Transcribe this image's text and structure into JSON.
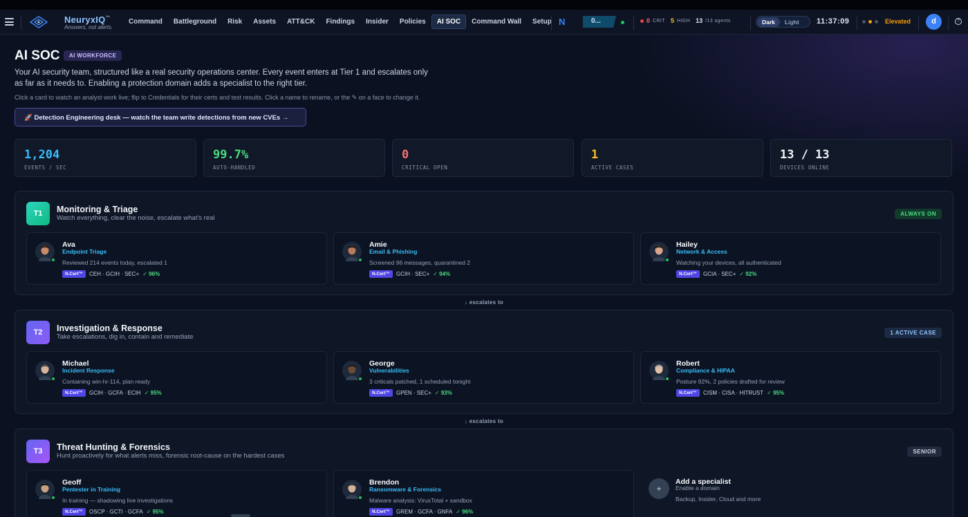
{
  "nav": {
    "brand": "NeuryxIQ",
    "brand_mark": "™",
    "tagline": "Answers, not alerts.",
    "links": [
      "Command",
      "Battleground",
      "Risk",
      "Assets",
      "ATT&CK",
      "Findings",
      "Insider",
      "Policies",
      "AI SOC",
      "Command Wall",
      "Setup"
    ],
    "active_link": "AI SOC",
    "n_label": "N",
    "pill": "0...",
    "crit_count": "0",
    "crit_label": "CRIT",
    "high_count": "5",
    "high_label": "HIGH",
    "agents_count": "13",
    "agents_label": "/13 agents",
    "mode_dark": "Dark",
    "mode_light": "Light",
    "clock": "11:37:09",
    "elevated": "Elevated",
    "avatar": "d",
    "help": "?"
  },
  "header": {
    "title": "AI SOC",
    "badge": "AI WORKFORCE",
    "intro": "Your AI security team, structured like a real security operations center. Every event enters at Tier 1 and escalates only as far as it needs to. Enabling a protection domain adds a specialist to the right tier.",
    "hint": "Click a card to watch an analyst work live; flip to Credentials for their certs and test results. Click a name to rename, or the ✎ on a face to change it.",
    "de_button": "🚀 Detection Engineering desk — watch the team write detections from new CVEs →"
  },
  "stats": [
    {
      "value": "1,204",
      "label": "EVENTS / SEC",
      "color": "#38bdf8"
    },
    {
      "value": "99.7%",
      "label": "AUTO-HANDLED",
      "color": "#4ade80"
    },
    {
      "value": "0",
      "label": "CRITICAL OPEN",
      "color": "#f87171"
    },
    {
      "value": "1",
      "label": "ACTIVE CASES",
      "color": "#fbbf24"
    },
    {
      "value": "13 / 13",
      "label": "DEVICES ONLINE",
      "color": "#f1f5f9"
    }
  ],
  "escalates_label": "↓ escalates to",
  "tiers": [
    {
      "badge": "T1",
      "title": "Monitoring & Triage",
      "subtitle": "Watch everything, clear the noise, escalate what's real",
      "pill": "ALWAYS ON",
      "agents": [
        {
          "name": "Ava",
          "role": "Endpoint Triage",
          "status": "Reviewed 214 events today, escalated 1",
          "ncert": "N.Cert™",
          "certs": "CEH · GCIH · SEC+",
          "score": "✓ 96%"
        },
        {
          "name": "Amie",
          "role": "Email & Phishing",
          "status": "Screened 96 messages, quarantined 2",
          "ncert": "N.Cert™",
          "certs": "GCIH · SEC+",
          "score": "✓ 94%"
        },
        {
          "name": "Hailey",
          "role": "Network & Access",
          "status": "Watching your devices, all authenticated",
          "ncert": "N.Cert™",
          "certs": "GCIA · SEC+",
          "score": "✓ 92%"
        }
      ]
    },
    {
      "badge": "T2",
      "title": "Investigation & Response",
      "subtitle": "Take escalations, dig in, contain and remediate",
      "pill": "1 ACTIVE CASE",
      "agents": [
        {
          "name": "Michael",
          "role": "Incident Response",
          "status": "Containing win-hr-114, plan ready",
          "ncert": "N.Cert™",
          "certs": "GCIH · GCFA · ECIH",
          "score": "✓ 95%"
        },
        {
          "name": "George",
          "role": "Vulnerabilities",
          "status": "3 criticals patched, 1 scheduled tonight",
          "ncert": "N.Cert™",
          "certs": "GPEN · SEC+",
          "score": "✓ 93%"
        },
        {
          "name": "Robert",
          "role": "Compliance & HIPAA",
          "status": "Posture 92%, 2 policies drafted for review",
          "ncert": "N.Cert™",
          "certs": "CISM · CISA · HITRUST",
          "score": "✓ 95%"
        }
      ]
    },
    {
      "badge": "T3",
      "title": "Threat Hunting & Forensics",
      "subtitle": "Hunt proactively for what alerts miss, forensic root-cause on the hardest cases",
      "pill": "SENIOR",
      "agents": [
        {
          "name": "Geoff",
          "role": "Pentester in Training",
          "status": "In training — shadowing live investigations",
          "ncert": "N.Cert™",
          "certs": "OSCP · GCTI · GCFA",
          "score": "✓ 95%"
        },
        {
          "name": "Brendon",
          "role": "Ransomware & Forensics",
          "status": "Malware analysis: VirusTotal + sandbox",
          "ncert": "N.Cert™",
          "certs": "GREM · GCFA · GNFA",
          "score": "✓ 96%"
        }
      ],
      "add": {
        "title": "Add a specialist",
        "subtitle": "Enable a domain",
        "detail": "Backup, Insider, Cloud and more",
        "plus": "+"
      }
    }
  ]
}
